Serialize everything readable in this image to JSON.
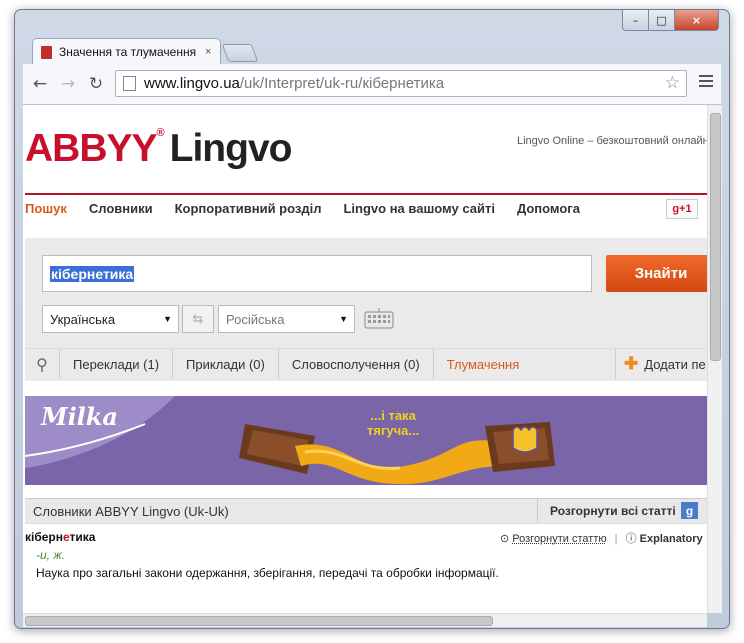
{
  "browser": {
    "tab_title": "Значення та тлумачення",
    "tab_close": "×",
    "url_host": "www.lingvo.ua",
    "url_path": "/uk/Interpret/uk-ru/кібернетика",
    "window_controls": {
      "minimize": "–",
      "maximize": "□",
      "close": "×"
    },
    "nav": {
      "back": "←",
      "forward": "→",
      "reload": "↻",
      "star": "☆"
    }
  },
  "header": {
    "logo_abbyy": "ABBYY",
    "logo_reg": "®",
    "logo_lingvo": "Lingvo",
    "promo": "Lingvo Online – безкоштовний онлайн"
  },
  "nav": {
    "items": [
      "Пошук",
      "Словники",
      "Корпоративний розділ",
      "Lingvo на вашому сайті",
      "Допомога"
    ],
    "gplus": "g+1"
  },
  "search": {
    "query": "кібернетика",
    "button": "Знайти",
    "from_lang": "Українська",
    "to_lang": "Російська",
    "swap": "⇆"
  },
  "result_tabs": {
    "items": [
      "Переклади (1)",
      "Приклади (0)",
      "Словосполучення (0)",
      "Тлумачення"
    ],
    "add": "Додати пе"
  },
  "ad": {
    "brand": "Milka",
    "slogan_line1": "...і така",
    "slogan_line2": "тягуча..."
  },
  "section": {
    "title": "Словники ABBYY Lingvo (Uk-Uk)",
    "expand_all": "Розгорнути всі статті",
    "google": "g"
  },
  "entry": {
    "head_pre": "кіберн",
    "head_stress": "е",
    "head_post": "тика",
    "grammar": "-и, ж.",
    "definition": "Наука про загальні закони одержання, зберігання, передачі та обробки інформації.",
    "expand_article": "Розгорнути статтю",
    "dictionary": "Explanatory"
  }
}
